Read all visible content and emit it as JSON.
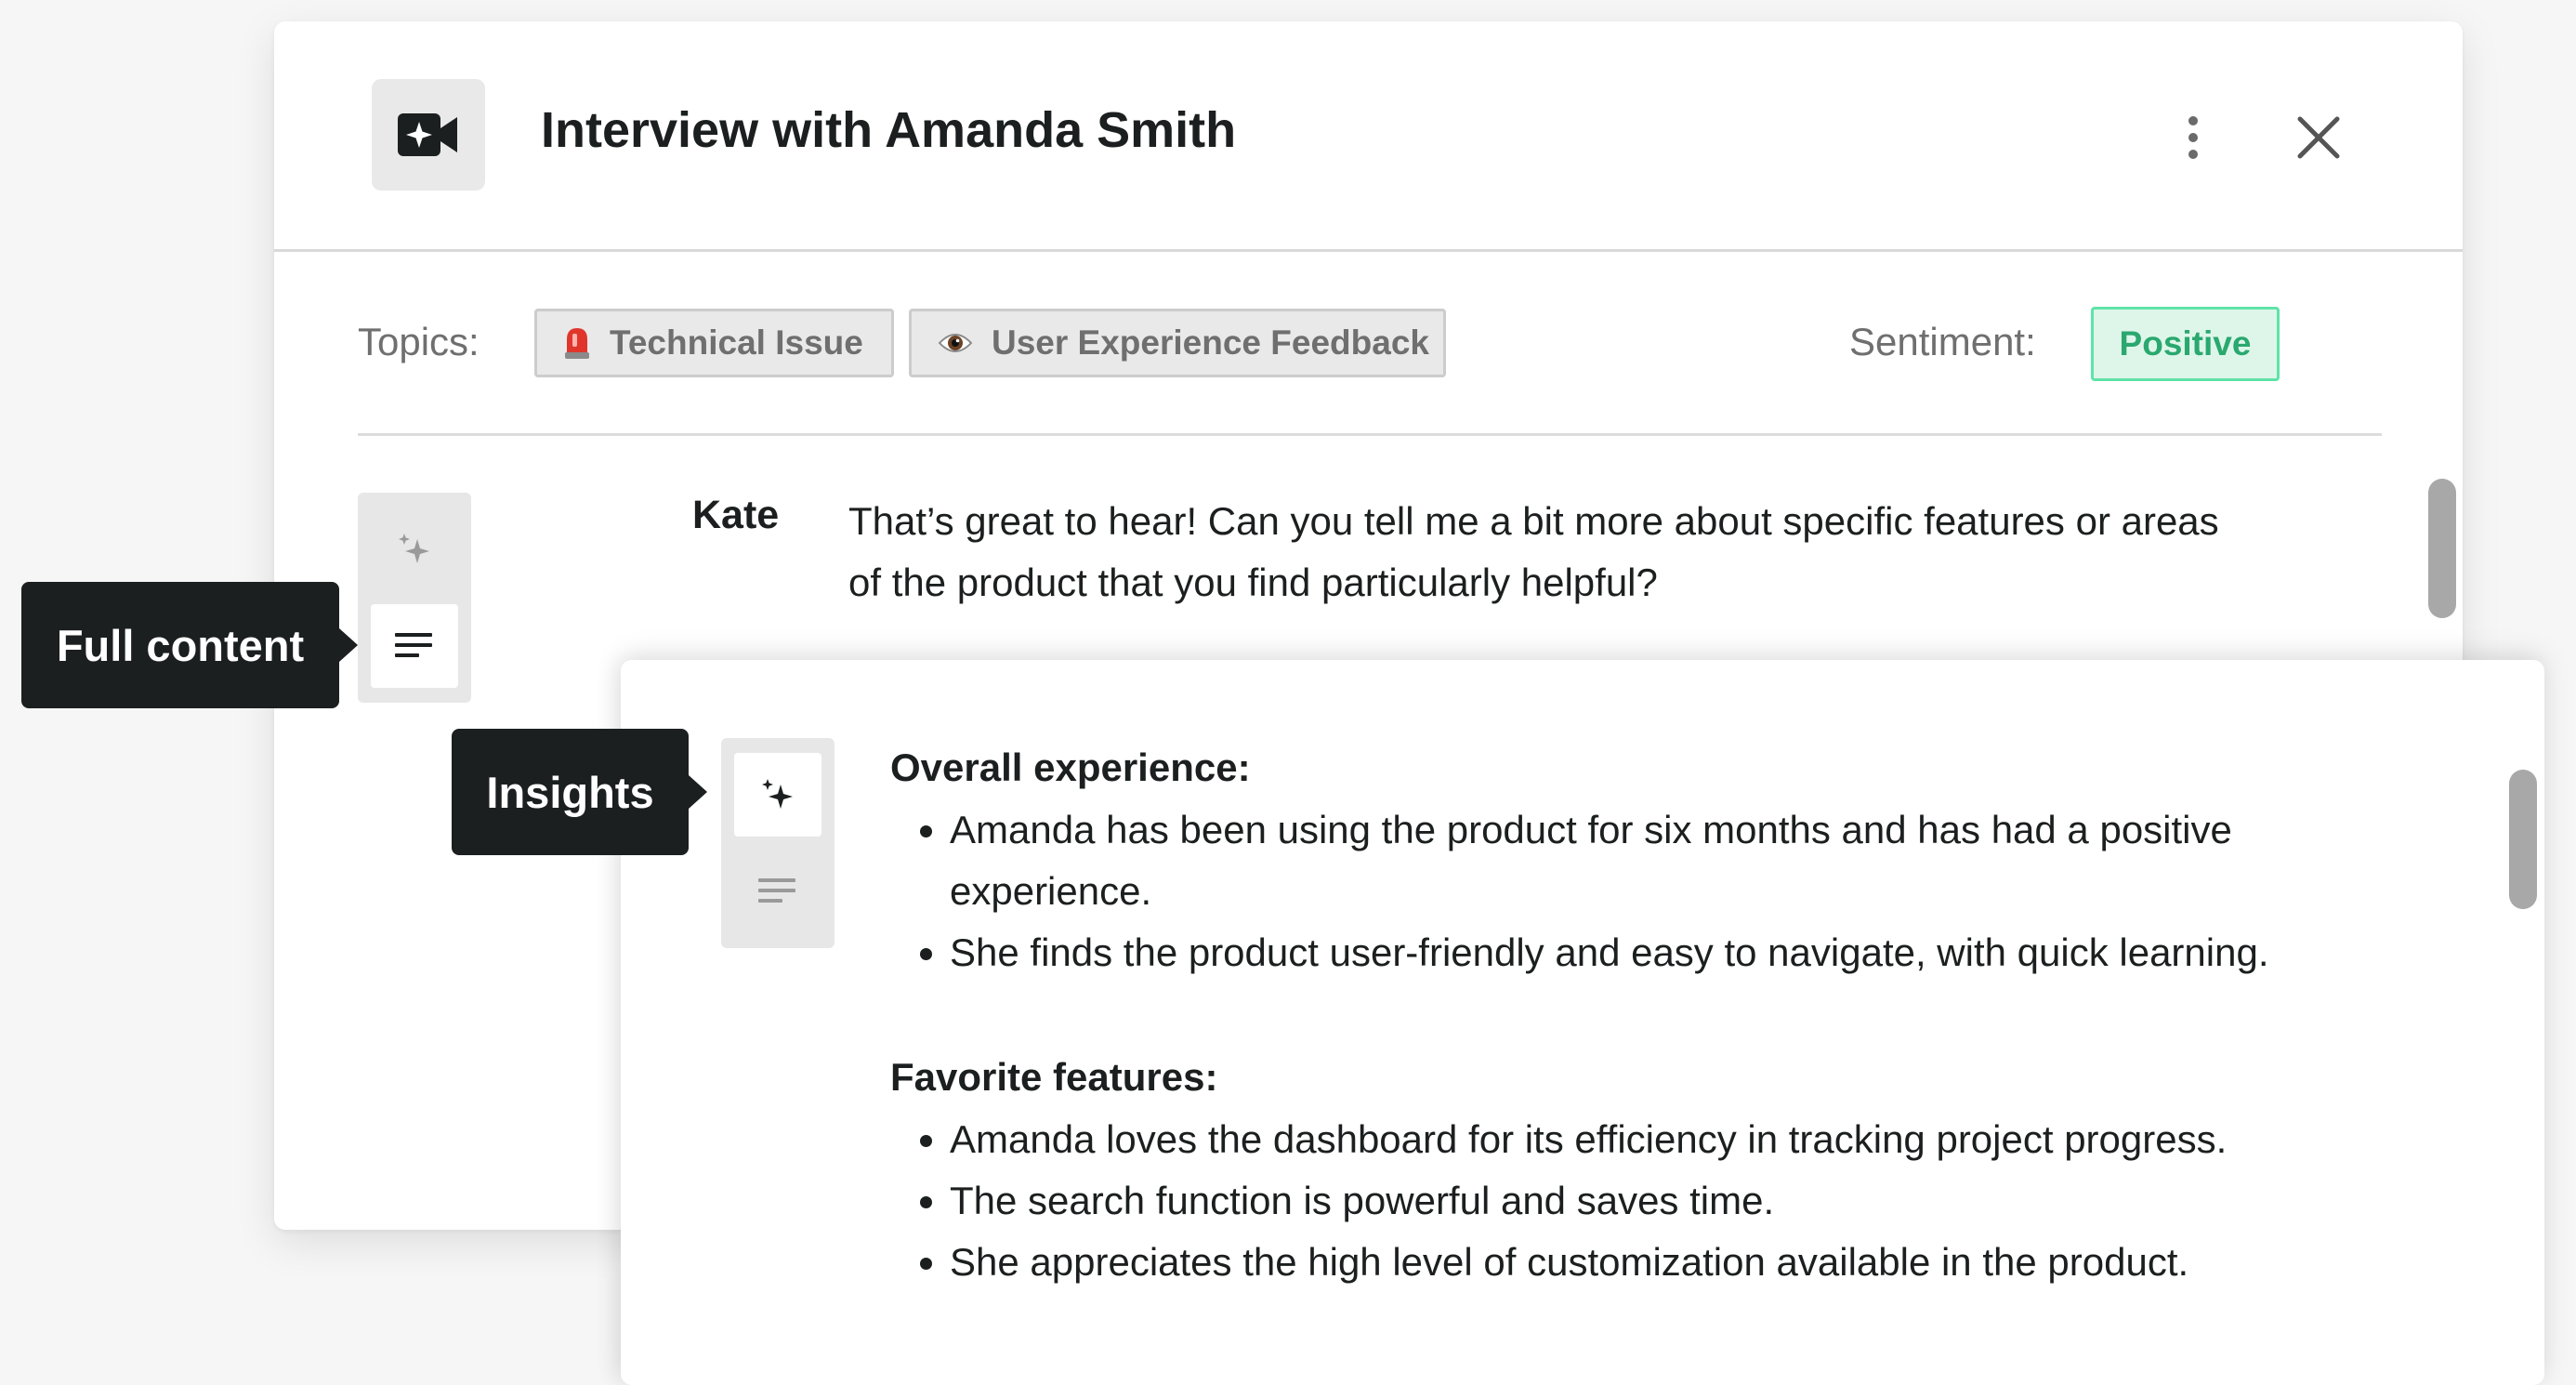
{
  "modal": {
    "title": "Interview with Amanda Smith",
    "icons": {
      "video": "video-sparkle-icon",
      "more": "more-vertical-icon",
      "close": "close-icon"
    }
  },
  "meta": {
    "topics_label": "Topics:",
    "topics": [
      {
        "emoji_icon": "siren-icon",
        "label": "Technical Issue"
      },
      {
        "emoji_icon": "eye-icon",
        "label": "User Experience Feedback"
      }
    ],
    "sentiment_label": "Sentiment:",
    "sentiment_value": "Positive",
    "sentiment_color": "#2aa86f"
  },
  "transcript": {
    "speaker": "Kate",
    "text": "That’s great to hear! Can you tell me a bit more about specific features or areas of the product that you find particularly helpful?"
  },
  "view_toggle": {
    "insights_icon": "sparkles-icon",
    "full_content_icon": "lines-icon"
  },
  "tooltips": {
    "full_content": "Full content",
    "insights": "Insights"
  },
  "insights": {
    "sections": [
      {
        "title": "Overall experience:",
        "items": [
          "Amanda has been using the product for six months and has had a positive experience.",
          "She finds the product user-friendly and easy to navigate, with quick learning."
        ]
      },
      {
        "title": "Favorite features:",
        "items": [
          "Amanda loves the dashboard for its efficiency in tracking project progress.",
          "The search function is powerful and saves time.",
          "She appreciates the high level of customization available in the product."
        ]
      }
    ]
  }
}
